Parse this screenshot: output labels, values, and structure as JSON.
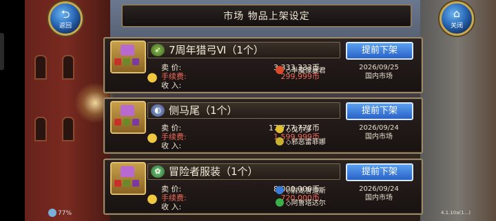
{
  "header": {
    "title": "市场  物品上架设定",
    "back_label": "返回",
    "close_label": "关闭"
  },
  "listings": [
    {
      "name": "7周年猎弓Ⅵ（1个）",
      "delist_label": "提前下架",
      "price_label": "卖  价:",
      "price": "3,333,333币",
      "fee_label": "手续费:",
      "fee": "299,999币",
      "income_label": "收  入:",
      "income": "",
      "buyers": [
        "◇半魔像暴君"
      ],
      "date": "2026/09/25",
      "market": "国内市场"
    },
    {
      "name": "侧马尾（1个）",
      "delist_label": "提前下架",
      "price_label": "卖  价:",
      "price": "17,777,777币",
      "fee_label": "手续费:",
      "fee": "1,599,999币",
      "income_label": "收  入:",
      "income": "",
      "buyers": [
        "◇戈尔多",
        "◇邪恶雷菲娜"
      ],
      "date": "2026/09/24",
      "market": "国内市场"
    },
    {
      "name": "冒险者服装（1个）",
      "delist_label": "提前下架",
      "price_label": "卖  价:",
      "price": "8,000,000币",
      "fee_label": "手续费:",
      "fee": "720,000币",
      "income_label": "收  入:",
      "income": "",
      "buyers": [
        "◇尉龙鲁迪斯",
        "◇阿鲁塔达尔"
      ],
      "date": "2026/09/24",
      "market": "国内市场"
    }
  ],
  "status": {
    "battery": "77%",
    "version": "4.1.10a(1...)"
  },
  "colors": {
    "fee_text": "#f06a5a",
    "button": "#3a7ee0"
  }
}
